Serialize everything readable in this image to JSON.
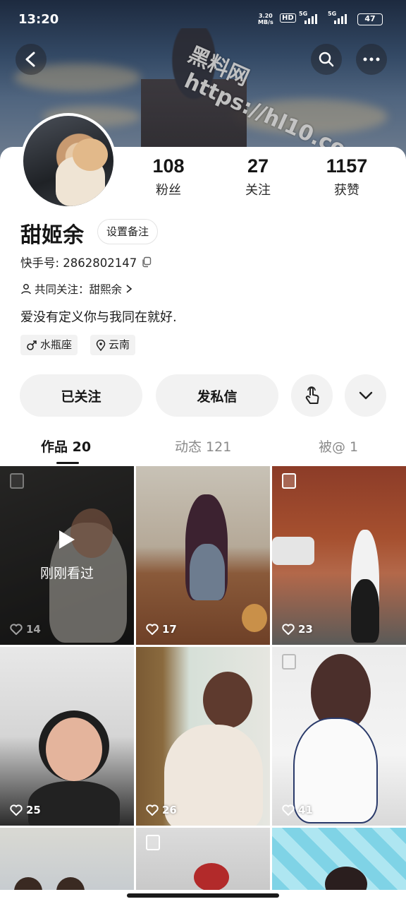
{
  "status_bar": {
    "time": "13:20",
    "net_speed_value": "3.20",
    "net_speed_unit": "MB/s",
    "hd_label": "HD",
    "sim1_label": "5G",
    "sim2_label": "5G",
    "battery": "47"
  },
  "watermark": {
    "line1": "黑料网",
    "line2": "https://hl10.co"
  },
  "header": {
    "back_icon": "back-arrow-icon",
    "search_icon": "search-icon",
    "more_icon": "more-dots-icon"
  },
  "profile": {
    "name": "甜姬余",
    "remark_button": "设置备注",
    "id_line": "快手号: 2862802147",
    "mutual_follow": "共同关注：甜熙余",
    "bio": "爱没有定义你与我同在就好.",
    "tags": [
      {
        "icon": "male-icon",
        "label": "水瓶座"
      },
      {
        "icon": "location-pin-icon",
        "label": "云南"
      }
    ]
  },
  "stats": [
    {
      "value": "108",
      "label": "粉丝"
    },
    {
      "value": "27",
      "label": "关注"
    },
    {
      "value": "1157",
      "label": "获赞"
    }
  ],
  "actions": {
    "followed": "已关注",
    "message": "发私信",
    "poke_icon": "tap-hand-icon",
    "expand_icon": "chevron-down-icon"
  },
  "tabs": [
    {
      "label": "作品 20",
      "active": true
    },
    {
      "label": "动态 121",
      "active": false
    },
    {
      "label": "被@ 1",
      "active": false
    }
  ],
  "grid": [
    {
      "likes": "14",
      "overlay": "刚刚看过"
    },
    {
      "likes": "17",
      "overlay": ""
    },
    {
      "likes": "23",
      "overlay": ""
    },
    {
      "likes": "25",
      "overlay": ""
    },
    {
      "likes": "26",
      "overlay": ""
    },
    {
      "likes": "41",
      "overlay": ""
    }
  ]
}
